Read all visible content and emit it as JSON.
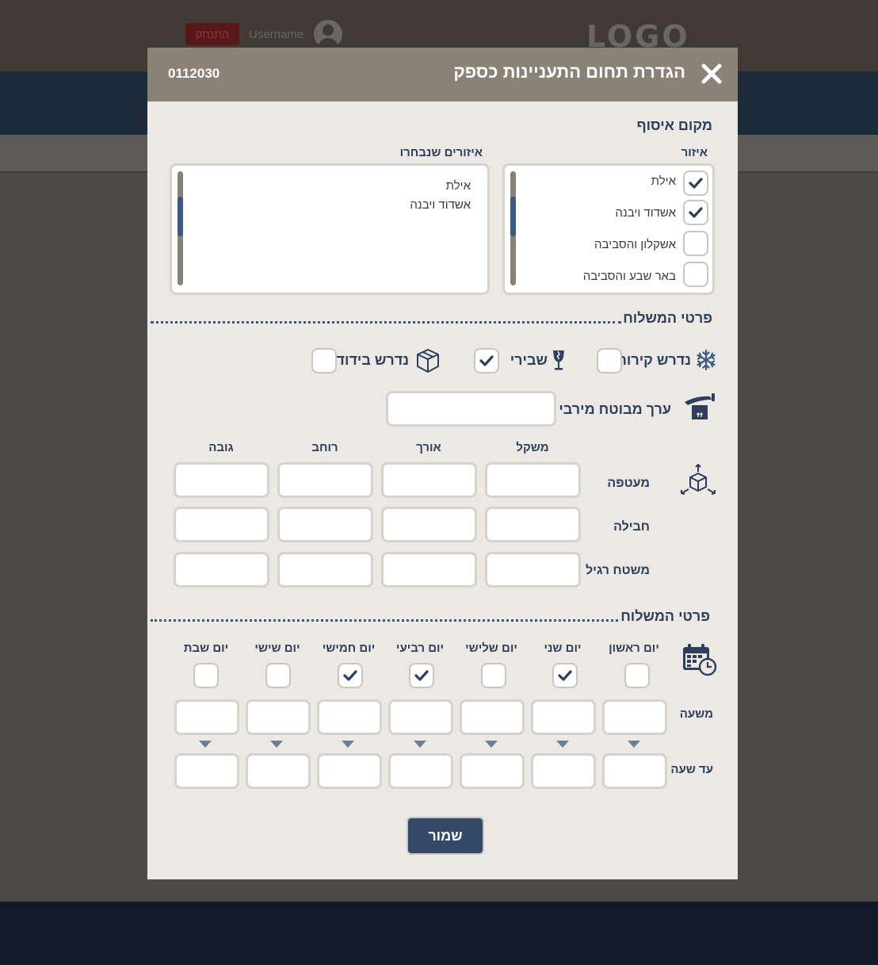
{
  "background": {
    "logo": "LOGO",
    "username": "Username",
    "logout_label": "התנתק"
  },
  "modal": {
    "title": "הגדרת תחום התעניינות כספק",
    "code": "0112030",
    "collection": {
      "title": "מקום איסוף",
      "region_label": "איזור",
      "selected_label": "איזורים שנבחרו",
      "regions": [
        {
          "label": "אילת",
          "checked": true
        },
        {
          "label": "אשדוד ויבנה",
          "checked": true
        },
        {
          "label": "אשקלון והסביבה",
          "checked": false
        },
        {
          "label": "באר שבע והסביבה",
          "checked": false
        }
      ],
      "selected_regions": [
        "אילת",
        "אשדוד ויבנה"
      ]
    },
    "shipment": {
      "title": "פרטי המשלוח",
      "options": [
        {
          "label": "נדרש קירור",
          "icon": "snowflake-icon",
          "checked": false
        },
        {
          "label": "שבירי",
          "icon": "fragile-glass-icon",
          "checked": true
        },
        {
          "label": "נדרש בידוד",
          "icon": "box-icon",
          "checked": false
        }
      ],
      "max_insured_label": "ערך מבוטח מירבי",
      "max_insured_value": "",
      "dimension_headers": [
        "משקל",
        "אורך",
        "רוחב",
        "גובה"
      ],
      "package_types": [
        "מעטפה",
        "חבילה",
        "משטח רגיל"
      ]
    },
    "schedule": {
      "title": "פרטי המשלוח",
      "days": [
        {
          "label": "יום ראשון",
          "checked": false
        },
        {
          "label": "יום שני",
          "checked": true
        },
        {
          "label": "יום שלישי",
          "checked": false
        },
        {
          "label": "יום רביעי",
          "checked": true
        },
        {
          "label": "יום חמישי",
          "checked": true
        },
        {
          "label": "יום שישי",
          "checked": false
        },
        {
          "label": "יום שבת",
          "checked": false
        }
      ],
      "from_label": "משעה",
      "to_label": "עד שעה"
    },
    "save_label": "שמור"
  },
  "colors": {
    "header": "#8b8277",
    "navy": "#2d3f5c",
    "modal_bg": "#ece8e3",
    "save": "#33496a"
  }
}
